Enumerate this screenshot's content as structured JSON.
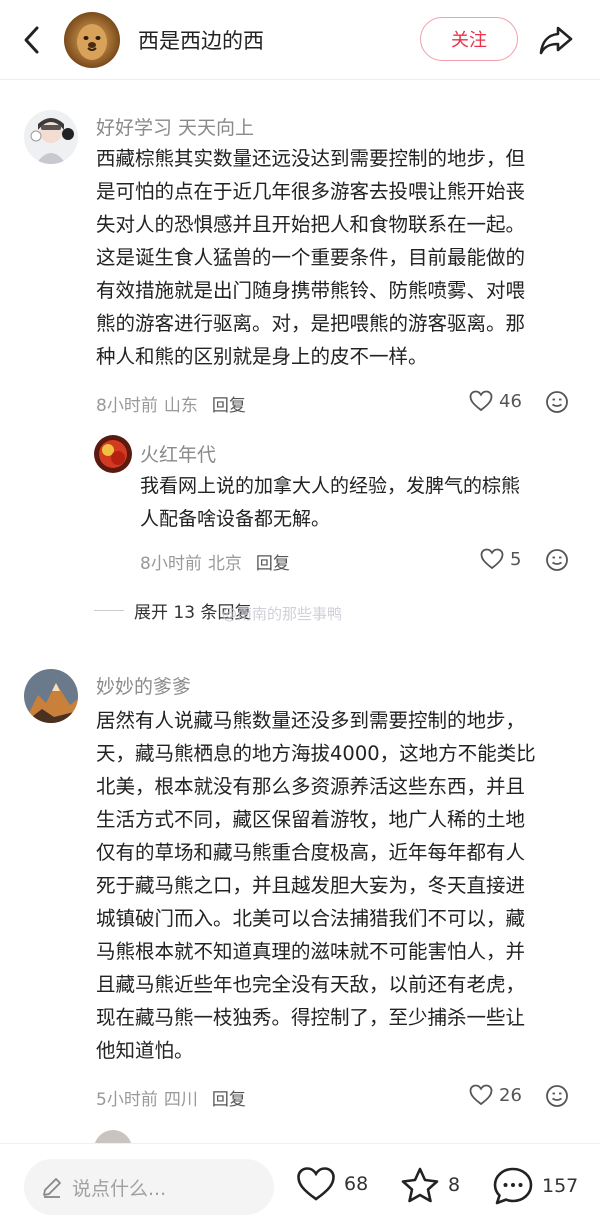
{
  "header": {
    "author_name": "西是西边的西",
    "follow_label": "关注"
  },
  "comments": [
    {
      "username": "好好学习 天天向上",
      "lines": [
        "西藏棕熊其实数量还远没达到需要控制的地步，但",
        "是可怕的点在于近几年很多游客去投喂让熊开始丧",
        "失对人的恐惧感并且开始把人和食物联系在一起。",
        "这是诞生食人猛兽的一个重要条件，目前最能做的",
        "有效措施就是出门随身携带熊铃、防熊喷雾、对喂",
        "熊的游客进行驱离。对，是把喂熊的游客驱离。那",
        "种人和熊的区别就是身上的皮不一样。"
      ],
      "time": "8小时前",
      "location": "山东",
      "reply_label": "回复",
      "likes": "46"
    },
    {
      "username": "火红年代",
      "lines": [
        "我看网上说的加拿大人的经验，发脾气的棕熊",
        "人配备啥设备都无解。"
      ],
      "time": "8小时前",
      "location": "北京",
      "reply_label": "回复",
      "likes": "5"
    },
    {
      "username": "妙妙的爹爹",
      "lines": [
        "居然有人说藏马熊数量还没多到需要控制的地步，",
        "天，藏马熊栖息的地方海拔4000，这地方不能类比",
        "北美，根本就没有那么多资源养活这些东西，并且",
        "生活方式不同，藏区保留着游牧，地广人稀的土地",
        "仅有的草场和藏马熊重合度极高，近年每年都有人",
        "死于藏马熊之口，并且越发胆大妄为，冬天直接进",
        "城镇破门而入。北美可以合法捕猎我们不可以，藏",
        "马熊根本就不知道真理的滋味就不可能害怕人，并",
        "且藏马熊近些年也完全没有天敌，以前还有老虎，",
        "现在藏马熊一枝独秀。得控制了，至少捕杀一些让",
        "他知道怕。"
      ],
      "time": "5小时前",
      "location": "四川",
      "reply_label": "回复",
      "likes": "26"
    }
  ],
  "expand_replies": "展开 13 条回复",
  "watermark": "@南南的那些事鸭",
  "bottom": {
    "input_placeholder": "说点什么...",
    "likes": "68",
    "stars": "8",
    "comments": "157"
  },
  "colors": {
    "accent": "#e8334a",
    "text_primary": "#222222",
    "text_secondary": "#999999"
  }
}
